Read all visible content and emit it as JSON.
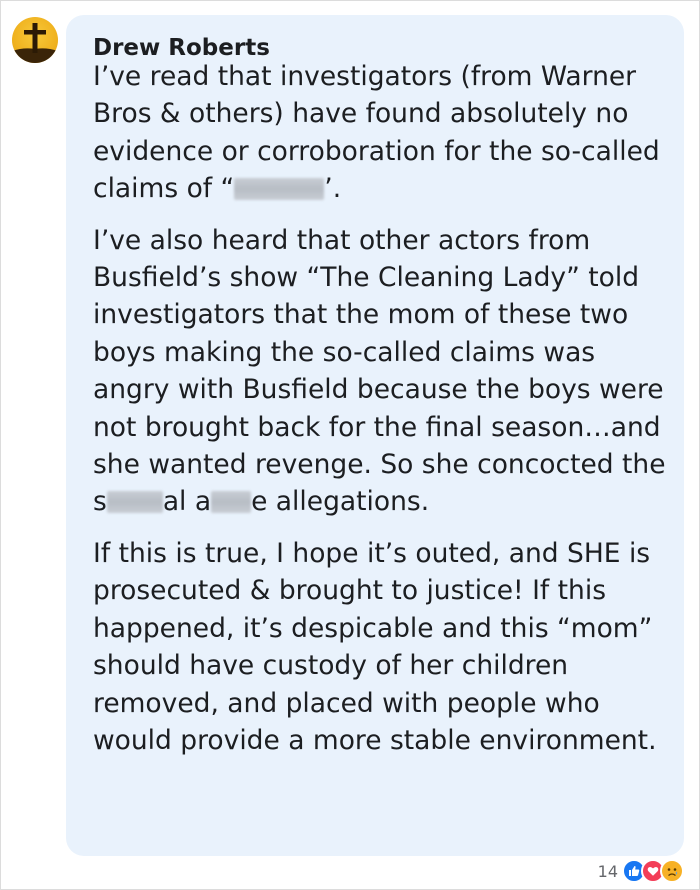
{
  "comment": {
    "author": "Drew Roberts",
    "paragraphs": [
      {
        "before": "I’ve read that investigators (from Warner Bros & others) have found absolutely no evidence or corroboration for the so-called claims of “",
        "after": "’."
      },
      {
        "before": "I’ve also heard that other actors from Busfield’s show “The Cleaning Lady” told investigators that the mom of these two boys making the so-called claims was angry with Busfield because the boys were not brought back for the final season…and she wanted revenge. So she concocted the s",
        "middle": "al a",
        "after": "e allegations."
      },
      {
        "text": "If this is true, I hope it’s outed, and SHE is prosecuted & brought to justice! If this happened, it’s despicable and this “mom” should have custody of her children removed, and placed with people who would provide a more stable environment."
      }
    ],
    "reactions": {
      "count": "14",
      "types": [
        "like-icon",
        "love-icon",
        "sad-icon"
      ]
    }
  },
  "colors": {
    "bubble": "#e9f2fc",
    "text": "#1c1e21",
    "like": "#1877f2",
    "love": "#f33e58",
    "sad": "#f7b125"
  }
}
